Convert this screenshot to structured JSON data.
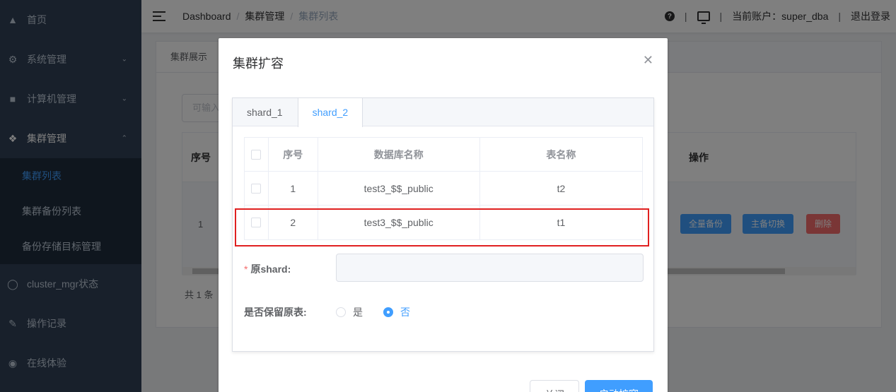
{
  "sidebar": {
    "items": [
      {
        "label": "首页",
        "icon": "home-icon"
      },
      {
        "label": "系统管理",
        "icon": "gear-icon"
      },
      {
        "label": "计算机管理",
        "icon": "monitor-icon"
      },
      {
        "label": "集群管理",
        "icon": "cluster-icon"
      },
      {
        "label": "cluster_mgr状态",
        "icon": "globe-icon"
      },
      {
        "label": "操作记录",
        "icon": "record-icon"
      },
      {
        "label": "在线体验",
        "icon": "database-icon"
      }
    ],
    "sub_items": [
      "集群列表",
      "集群备份列表",
      "备份存储目标管理"
    ]
  },
  "header": {
    "breadcrumb": [
      "Dashboard",
      "集群管理",
      "集群列表"
    ],
    "account_label": "当前账户：super_dba",
    "logout_label": "退出登录"
  },
  "background": {
    "tab_label": "集群展示",
    "input_placeholder": "可输入",
    "col_index": "序号",
    "col_ops": "操作",
    "row_index": "1",
    "buttons": [
      "全量备份",
      "主备切换",
      "删除"
    ],
    "total": "共 1 条"
  },
  "modal": {
    "title": "集群扩容",
    "tabs": [
      "shard_1",
      "shard_2"
    ],
    "table": {
      "headers": [
        "序号",
        "数据库名称",
        "表名称"
      ],
      "rows": [
        {
          "index": "1",
          "db": "test3_$$_public",
          "table": "t2"
        },
        {
          "index": "2",
          "db": "test3_$$_public",
          "table": "t1"
        }
      ]
    },
    "source_shard_label": "原shard:",
    "keep_table_label": "是否保留原表:",
    "radio_yes": "是",
    "radio_no": "否",
    "cancel_label": "关闭",
    "confirm_label": "启动扩容"
  }
}
